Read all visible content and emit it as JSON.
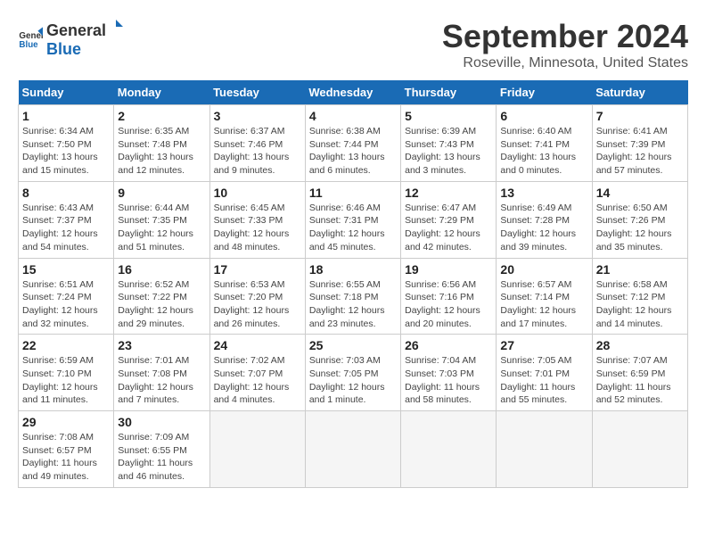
{
  "logo": {
    "general": "General",
    "blue": "Blue"
  },
  "title": "September 2024",
  "location": "Roseville, Minnesota, United States",
  "headers": [
    "Sunday",
    "Monday",
    "Tuesday",
    "Wednesday",
    "Thursday",
    "Friday",
    "Saturday"
  ],
  "weeks": [
    [
      {
        "day": "1",
        "rise": "6:34 AM",
        "set": "7:50 PM",
        "hours": "13 hours and 15 minutes."
      },
      {
        "day": "2",
        "rise": "6:35 AM",
        "set": "7:48 PM",
        "hours": "13 hours and 12 minutes."
      },
      {
        "day": "3",
        "rise": "6:37 AM",
        "set": "7:46 PM",
        "hours": "13 hours and 9 minutes."
      },
      {
        "day": "4",
        "rise": "6:38 AM",
        "set": "7:44 PM",
        "hours": "13 hours and 6 minutes."
      },
      {
        "day": "5",
        "rise": "6:39 AM",
        "set": "7:43 PM",
        "hours": "13 hours and 3 minutes."
      },
      {
        "day": "6",
        "rise": "6:40 AM",
        "set": "7:41 PM",
        "hours": "13 hours and 0 minutes."
      },
      {
        "day": "7",
        "rise": "6:41 AM",
        "set": "7:39 PM",
        "hours": "12 hours and 57 minutes."
      }
    ],
    [
      {
        "day": "8",
        "rise": "6:43 AM",
        "set": "7:37 PM",
        "hours": "12 hours and 54 minutes."
      },
      {
        "day": "9",
        "rise": "6:44 AM",
        "set": "7:35 PM",
        "hours": "12 hours and 51 minutes."
      },
      {
        "day": "10",
        "rise": "6:45 AM",
        "set": "7:33 PM",
        "hours": "12 hours and 48 minutes."
      },
      {
        "day": "11",
        "rise": "6:46 AM",
        "set": "7:31 PM",
        "hours": "12 hours and 45 minutes."
      },
      {
        "day": "12",
        "rise": "6:47 AM",
        "set": "7:29 PM",
        "hours": "12 hours and 42 minutes."
      },
      {
        "day": "13",
        "rise": "6:49 AM",
        "set": "7:28 PM",
        "hours": "12 hours and 39 minutes."
      },
      {
        "day": "14",
        "rise": "6:50 AM",
        "set": "7:26 PM",
        "hours": "12 hours and 35 minutes."
      }
    ],
    [
      {
        "day": "15",
        "rise": "6:51 AM",
        "set": "7:24 PM",
        "hours": "12 hours and 32 minutes."
      },
      {
        "day": "16",
        "rise": "6:52 AM",
        "set": "7:22 PM",
        "hours": "12 hours and 29 minutes."
      },
      {
        "day": "17",
        "rise": "6:53 AM",
        "set": "7:20 PM",
        "hours": "12 hours and 26 minutes."
      },
      {
        "day": "18",
        "rise": "6:55 AM",
        "set": "7:18 PM",
        "hours": "12 hours and 23 minutes."
      },
      {
        "day": "19",
        "rise": "6:56 AM",
        "set": "7:16 PM",
        "hours": "12 hours and 20 minutes."
      },
      {
        "day": "20",
        "rise": "6:57 AM",
        "set": "7:14 PM",
        "hours": "12 hours and 17 minutes."
      },
      {
        "day": "21",
        "rise": "6:58 AM",
        "set": "7:12 PM",
        "hours": "12 hours and 14 minutes."
      }
    ],
    [
      {
        "day": "22",
        "rise": "6:59 AM",
        "set": "7:10 PM",
        "hours": "12 hours and 11 minutes."
      },
      {
        "day": "23",
        "rise": "7:01 AM",
        "set": "7:08 PM",
        "hours": "12 hours and 7 minutes."
      },
      {
        "day": "24",
        "rise": "7:02 AM",
        "set": "7:07 PM",
        "hours": "12 hours and 4 minutes."
      },
      {
        "day": "25",
        "rise": "7:03 AM",
        "set": "7:05 PM",
        "hours": "12 hours and 1 minute."
      },
      {
        "day": "26",
        "rise": "7:04 AM",
        "set": "7:03 PM",
        "hours": "11 hours and 58 minutes."
      },
      {
        "day": "27",
        "rise": "7:05 AM",
        "set": "7:01 PM",
        "hours": "11 hours and 55 minutes."
      },
      {
        "day": "28",
        "rise": "7:07 AM",
        "set": "6:59 PM",
        "hours": "11 hours and 52 minutes."
      }
    ],
    [
      {
        "day": "29",
        "rise": "7:08 AM",
        "set": "6:57 PM",
        "hours": "11 hours and 49 minutes."
      },
      {
        "day": "30",
        "rise": "7:09 AM",
        "set": "6:55 PM",
        "hours": "11 hours and 46 minutes."
      },
      null,
      null,
      null,
      null,
      null
    ]
  ],
  "labels": {
    "sunrise": "Sunrise:",
    "sunset": "Sunset:",
    "daylight": "Daylight:"
  }
}
